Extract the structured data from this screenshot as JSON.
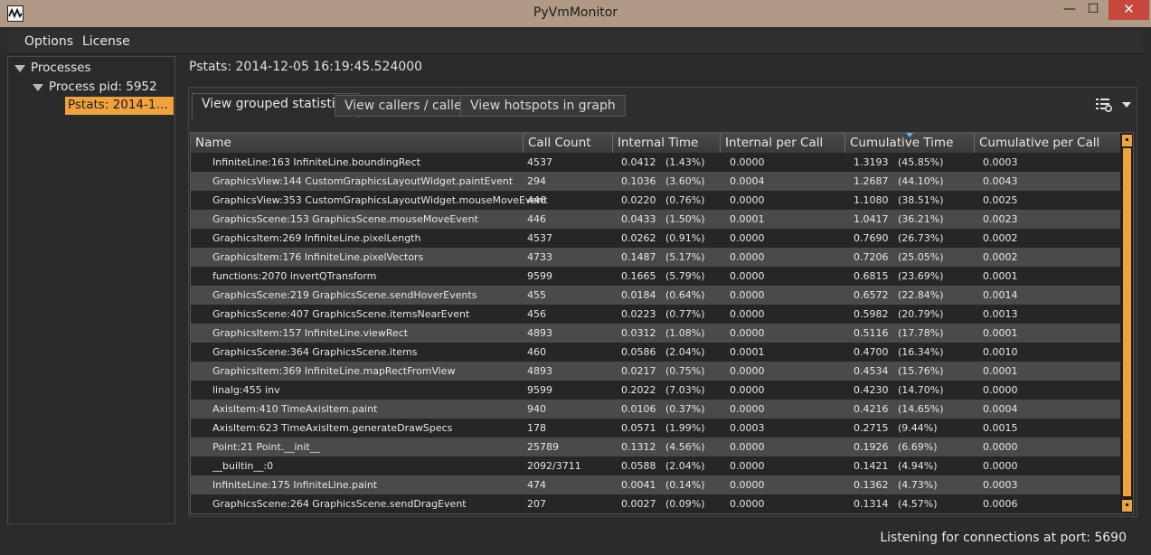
{
  "window": {
    "title": "PyVmMonitor",
    "min_glyph": "—",
    "max_glyph": "☐",
    "close_glyph": "✕"
  },
  "menu": {
    "options": "Options",
    "license": "License"
  },
  "tree": {
    "processes": "Processes",
    "process": "Process pid: 5952",
    "pstats": "Pstats: 2014-12-05 16:19:45.524000"
  },
  "main": {
    "header": "Pstats: 2014-12-05 16:19:45.524000",
    "tabs": [
      "View grouped statistics",
      "View callers / callees",
      "View hotspots in graph"
    ],
    "toolbar_icon": "settings-list-icon"
  },
  "table": {
    "columns": [
      "Name",
      "Call Count",
      "Internal Time",
      "Internal per Call",
      "Cumulative Time",
      "Cumulative per Call"
    ],
    "sorted_column": "Cumulative Time",
    "rows": [
      [
        "InfiniteLine:163 InfiniteLine.boundingRect",
        "4537",
        "0.0412",
        "(1.43%)",
        "0.0000",
        "1.3193",
        "(45.85%)",
        "0.0003"
      ],
      [
        "GraphicsView:144 CustomGraphicsLayoutWidget.paintEvent",
        "294",
        "0.1036",
        "(3.60%)",
        "0.0004",
        "1.2687",
        "(44.10%)",
        "0.0043"
      ],
      [
        "GraphicsView:353 CustomGraphicsLayoutWidget.mouseMoveEvent",
        "446",
        "0.0220",
        "(0.76%)",
        "0.0000",
        "1.1080",
        "(38.51%)",
        "0.0025"
      ],
      [
        "GraphicsScene:153 GraphicsScene.mouseMoveEvent",
        "446",
        "0.0433",
        "(1.50%)",
        "0.0001",
        "1.0417",
        "(36.21%)",
        "0.0023"
      ],
      [
        "GraphicsItem:269 InfiniteLine.pixelLength",
        "4537",
        "0.0262",
        "(0.91%)",
        "0.0000",
        "0.7690",
        "(26.73%)",
        "0.0002"
      ],
      [
        "GraphicsItem:176 InfiniteLine.pixelVectors",
        "4733",
        "0.1487",
        "(5.17%)",
        "0.0000",
        "0.7206",
        "(25.05%)",
        "0.0002"
      ],
      [
        "functions:2070 invertQTransform",
        "9599",
        "0.1665",
        "(5.79%)",
        "0.0000",
        "0.6815",
        "(23.69%)",
        "0.0001"
      ],
      [
        "GraphicsScene:219 GraphicsScene.sendHoverEvents",
        "455",
        "0.0184",
        "(0.64%)",
        "0.0000",
        "0.6572",
        "(22.84%)",
        "0.0014"
      ],
      [
        "GraphicsScene:407 GraphicsScene.itemsNearEvent",
        "456",
        "0.0223",
        "(0.77%)",
        "0.0000",
        "0.5982",
        "(20.79%)",
        "0.0013"
      ],
      [
        "GraphicsItem:157 InfiniteLine.viewRect",
        "4893",
        "0.0312",
        "(1.08%)",
        "0.0000",
        "0.5116",
        "(17.78%)",
        "0.0001"
      ],
      [
        "GraphicsScene:364 GraphicsScene.items",
        "460",
        "0.0586",
        "(2.04%)",
        "0.0001",
        "0.4700",
        "(16.34%)",
        "0.0010"
      ],
      [
        "GraphicsItem:369 InfiniteLine.mapRectFromView",
        "4893",
        "0.0217",
        "(0.75%)",
        "0.0000",
        "0.4534",
        "(15.76%)",
        "0.0001"
      ],
      [
        "linalg:455 inv",
        "9599",
        "0.2022",
        "(7.03%)",
        "0.0000",
        "0.4230",
        "(14.70%)",
        "0.0000"
      ],
      [
        "AxisItem:410 TimeAxisItem.paint",
        "940",
        "0.0106",
        "(0.37%)",
        "0.0000",
        "0.4216",
        "(14.65%)",
        "0.0004"
      ],
      [
        "AxisItem:623 TimeAxisItem.generateDrawSpecs",
        "178",
        "0.0571",
        "(1.99%)",
        "0.0003",
        "0.2715",
        "(9.44%)",
        "0.0015"
      ],
      [
        "Point:21 Point.__init__",
        "25789",
        "0.1312",
        "(4.56%)",
        "0.0000",
        "0.1926",
        "(6.69%)",
        "0.0000"
      ],
      [
        "__builtin__:0",
        "2092/3711",
        "0.0588",
        "(2.04%)",
        "0.0000",
        "0.1421",
        "(4.94%)",
        "0.0000"
      ],
      [
        "InfiniteLine:175 InfiniteLine.paint",
        "474",
        "0.0041",
        "(0.14%)",
        "0.0000",
        "0.1362",
        "(4.73%)",
        "0.0003"
      ],
      [
        "GraphicsScene:264 GraphicsScene.sendDragEvent",
        "207",
        "0.0027",
        "(0.09%)",
        "0.0000",
        "0.1314",
        "(4.57%)",
        "0.0006"
      ]
    ]
  },
  "status": {
    "text": "Listening for connections at port: 5690"
  },
  "colors": {
    "accent": "#f0a23c",
    "titlebar": "#b09a86",
    "close": "#c7473c",
    "sort_indicator": "#5ab4ff"
  }
}
